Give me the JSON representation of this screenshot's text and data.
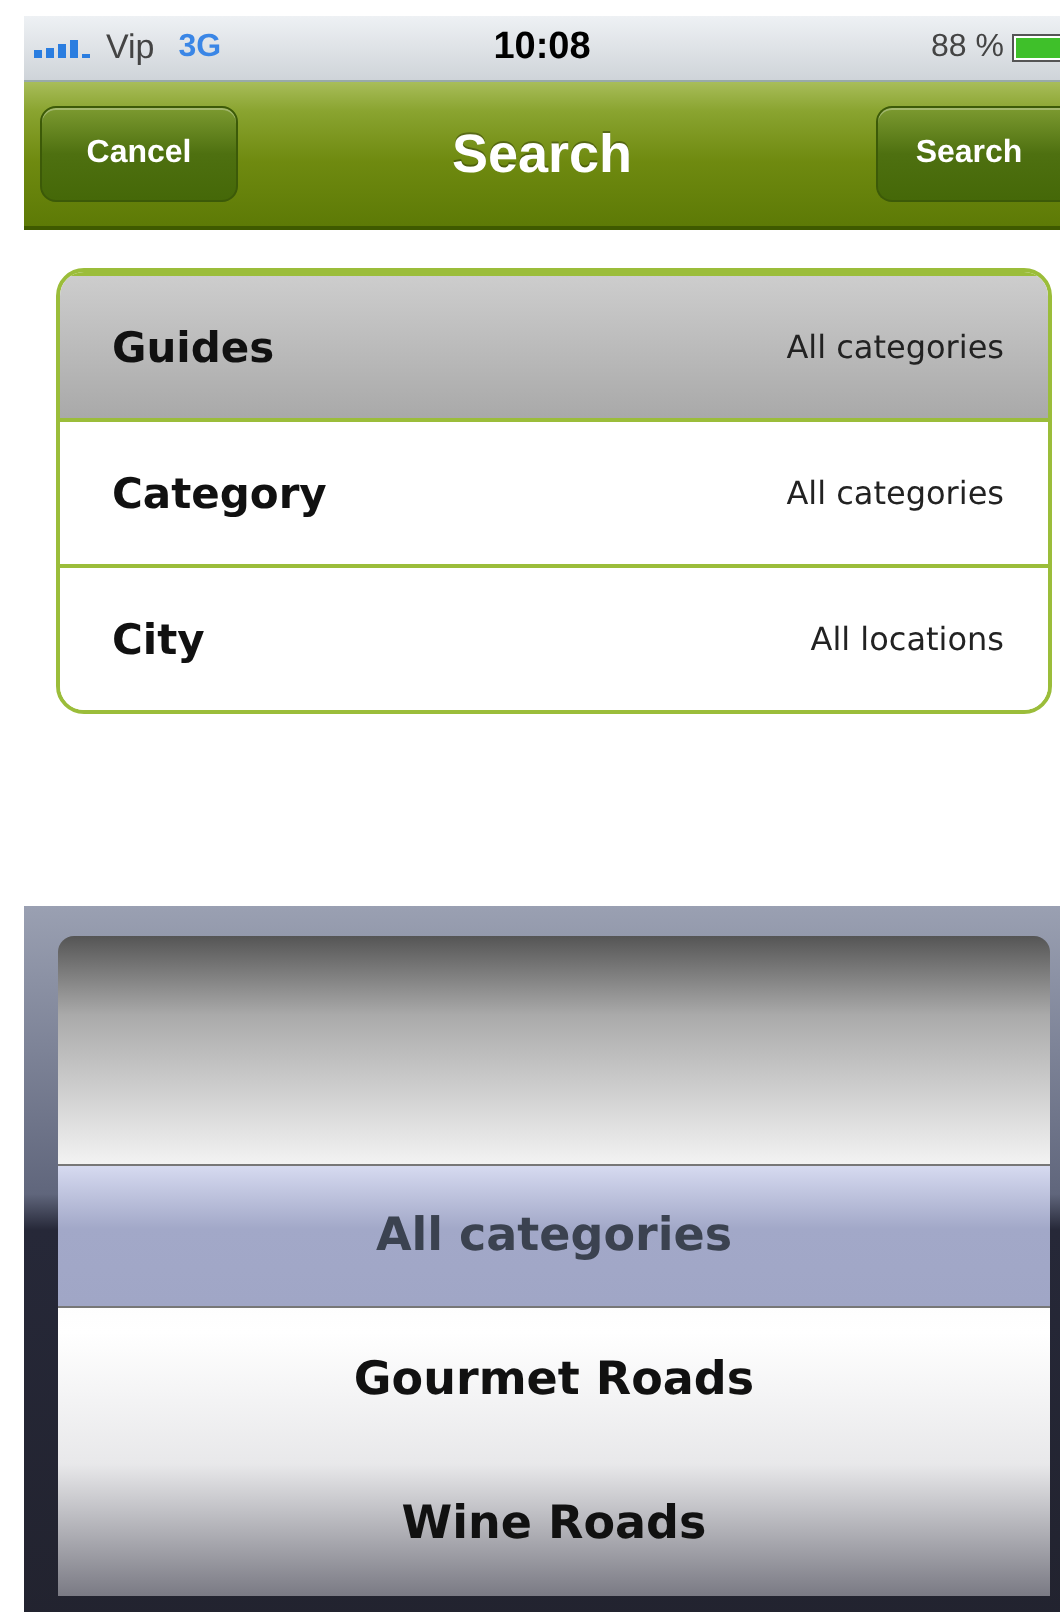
{
  "status_bar": {
    "carrier": "Vip",
    "network": "3G",
    "time": "10:08",
    "battery": "88 %"
  },
  "nav_bar": {
    "left_button": "Cancel",
    "title": "Search",
    "right_button": "Search"
  },
  "fields": [
    {
      "label": "Guides",
      "value": "All categories",
      "selected": true
    },
    {
      "label": "Category",
      "value": "All categories",
      "selected": false
    },
    {
      "label": "City",
      "value": "All locations",
      "selected": false
    }
  ],
  "picker": {
    "items": [
      {
        "label": "All categories",
        "selected": true
      },
      {
        "label": "Gourmet Roads",
        "selected": false
      },
      {
        "label": "Wine Roads",
        "selected": false
      }
    ]
  }
}
